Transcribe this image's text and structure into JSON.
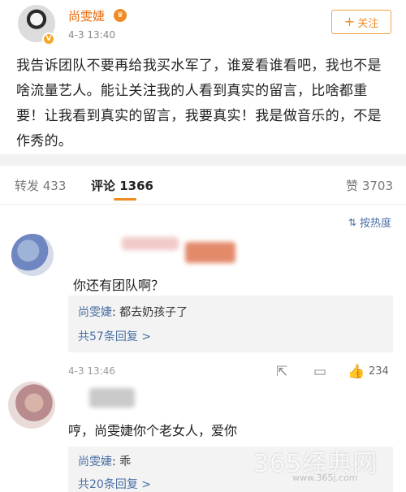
{
  "post": {
    "author": "尚雯婕",
    "time": "4-3 13:40",
    "follow_label": "关注",
    "text": "我告诉团队不要再给我买水军了，谁爱看谁看吧，我也不是啥流量艺人。能让关注我的人看到真实的留言，比啥都重要！让我看到真实的留言，我要真实！我是做音乐的，不是作秀的。"
  },
  "tabs": {
    "repost": "转发 433",
    "comments": "评论 1366",
    "likes": "赞 3703"
  },
  "sort_label": "按热度",
  "comments": [
    {
      "text": "你还有团队啊？",
      "reply_author": "尚雯婕",
      "reply_text": "都去奶孩子了",
      "reply_more": "共57条回复 >",
      "time": "4-3 13:46",
      "likes": "234"
    },
    {
      "text": "哼，尚雯婕你个老女人，爱你",
      "reply_author": "尚雯婕",
      "reply_text": "乖",
      "reply_more": "共20条回复 >"
    }
  ],
  "watermark": {
    "text": "365经典网",
    "url": "www.365j.com"
  },
  "colors": {
    "accent": "#f08a24",
    "link": "#4a6fa5",
    "separator": "#f2f2f2"
  }
}
